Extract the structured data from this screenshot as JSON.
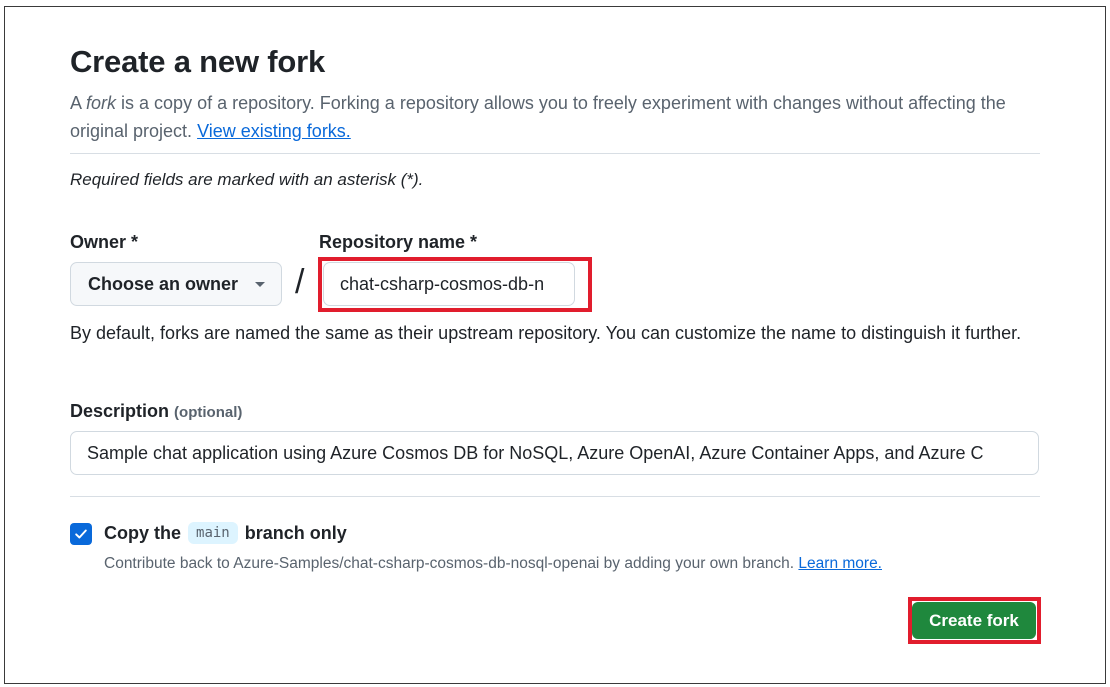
{
  "page": {
    "title": "Create a new fork",
    "intro_prefix": "A ",
    "intro_fork_word": "fork",
    "intro_text": " is a copy of a repository. Forking a repository allows you to freely experiment with changes without affecting the original project. ",
    "view_forks_link": "View existing forks.",
    "required_note": "Required fields are marked with an asterisk (*)."
  },
  "owner": {
    "label": "Owner *",
    "selected_value": "Choose an owner"
  },
  "separator": "/",
  "repository": {
    "label": "Repository name *",
    "value": "chat-csharp-cosmos-db-n"
  },
  "naming_hint": "By default, forks are named the same as their upstream repository. You can customize the name to distinguish it further.",
  "description": {
    "label": "Description",
    "optional_tag": "(optional)",
    "value": "Sample chat application using Azure Cosmos DB for NoSQL, Azure OpenAI, Azure Container Apps, and Azure C"
  },
  "copy_branch": {
    "checked": true,
    "label_prefix": "Copy the",
    "branch_name": "main",
    "label_suffix": "branch only",
    "contribute_text": "Contribute back to Azure-Samples/chat-csharp-cosmos-db-nosql-openai by adding your own branch. ",
    "learn_more_link": "Learn more."
  },
  "actions": {
    "create_label": "Create fork"
  },
  "colors": {
    "primary_button": "#1f883d",
    "link": "#0969da",
    "checkbox": "#0969da",
    "highlight_box": "#e11d2d"
  }
}
